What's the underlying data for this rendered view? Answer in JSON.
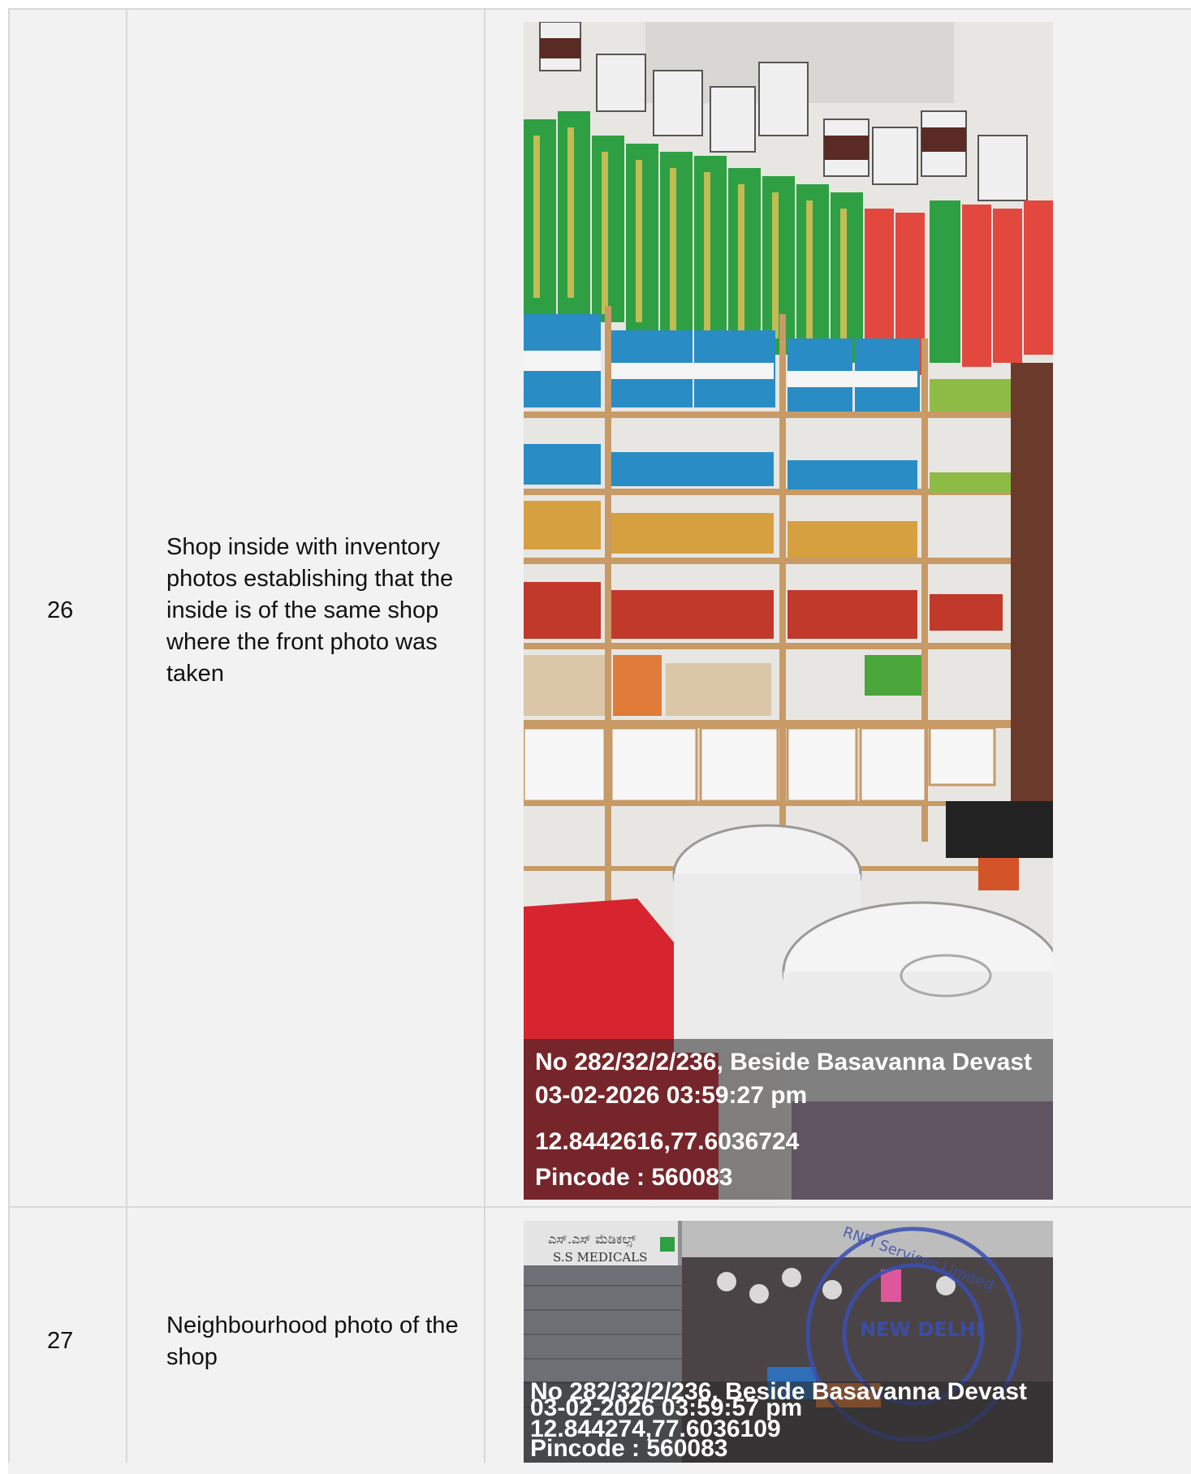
{
  "rows": [
    {
      "number": "26",
      "description": "Shop inside with inventory photos establishing that the inside is of the same shop where the front photo was taken",
      "photo": {
        "subject": "shop-interior-shelves",
        "address": "No 282/32/2/236, Beside Basavanna Devast",
        "datetime": "03-02-2026 03:59:27 pm",
        "coordinates": "12.8442616,77.6036724",
        "pincode": "Pincode : 560083"
      }
    },
    {
      "number": "27",
      "description": "Neighbourhood photo of the shop",
      "photo": {
        "subject": "shop-front-street",
        "signboard_kannada": "ಎಸ್.ಎಸ್ ಮೆಡಿಕಲ್ಸ್",
        "signboard": "S.S MEDICALS",
        "stamp_text": "RNFI Services Limited",
        "stamp_center": "NEW DELHI",
        "address": "No 282/32/2/236, Beside Basavanna Devast",
        "datetime": "03-02-2026 03:59:57 pm",
        "coordinates": "12.844274,77.6036109",
        "pincode": "Pincode : 560083"
      }
    }
  ]
}
